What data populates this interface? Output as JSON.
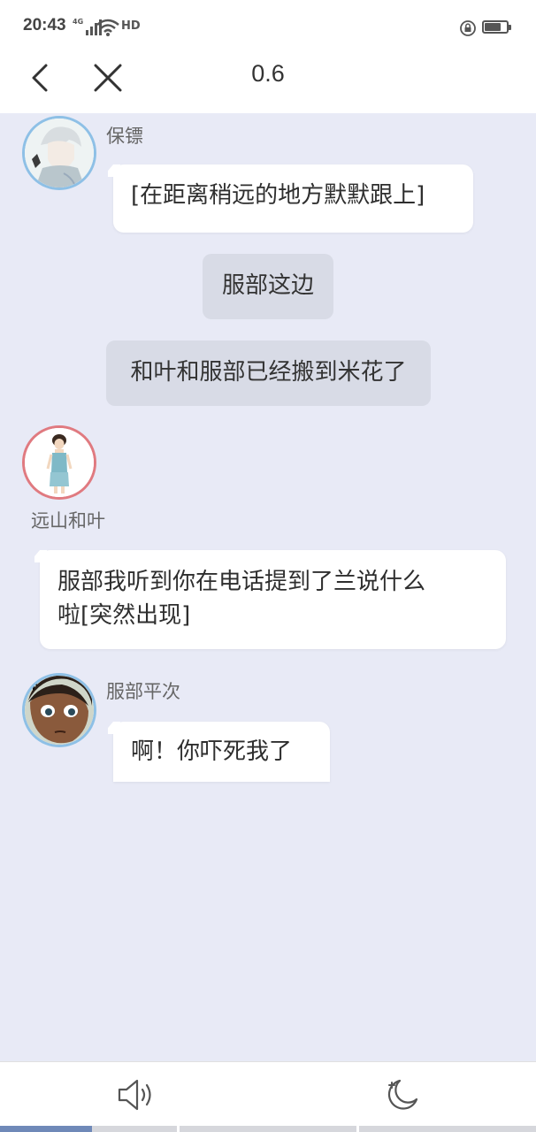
{
  "status_bar": {
    "time": "20:43",
    "network": "4G",
    "hd": "HD",
    "battery_level": 0.75
  },
  "nav": {
    "title": "0.6"
  },
  "messages": {
    "m1": {
      "sender": "保镖",
      "text": "[在距离稍远的地方默默跟上]"
    },
    "n1": {
      "text": "服部这边"
    },
    "n2": {
      "text": "和叶和服部已经搬到米花了"
    },
    "m2": {
      "sender": "远山和叶",
      "text_line1": "服部我听到你在电话提到了兰说什么",
      "text_line2": "啦[突然出现]"
    },
    "m3": {
      "sender": "服部平次",
      "text": "啊！你吓死我了"
    }
  },
  "bottom_bar": {
    "icons": [
      "speaker-icon",
      "night-mode-icon"
    ]
  },
  "progress": {
    "segments": 3,
    "first_segment_fill": 0.52
  },
  "colors": {
    "chat_bg": "#e8eaf6",
    "narration_bg": "#d8dbe6",
    "avatar_border_blue": "#8ec0e6",
    "avatar_border_pink": "#e07a80",
    "progress_fill": "#6f89b8"
  }
}
